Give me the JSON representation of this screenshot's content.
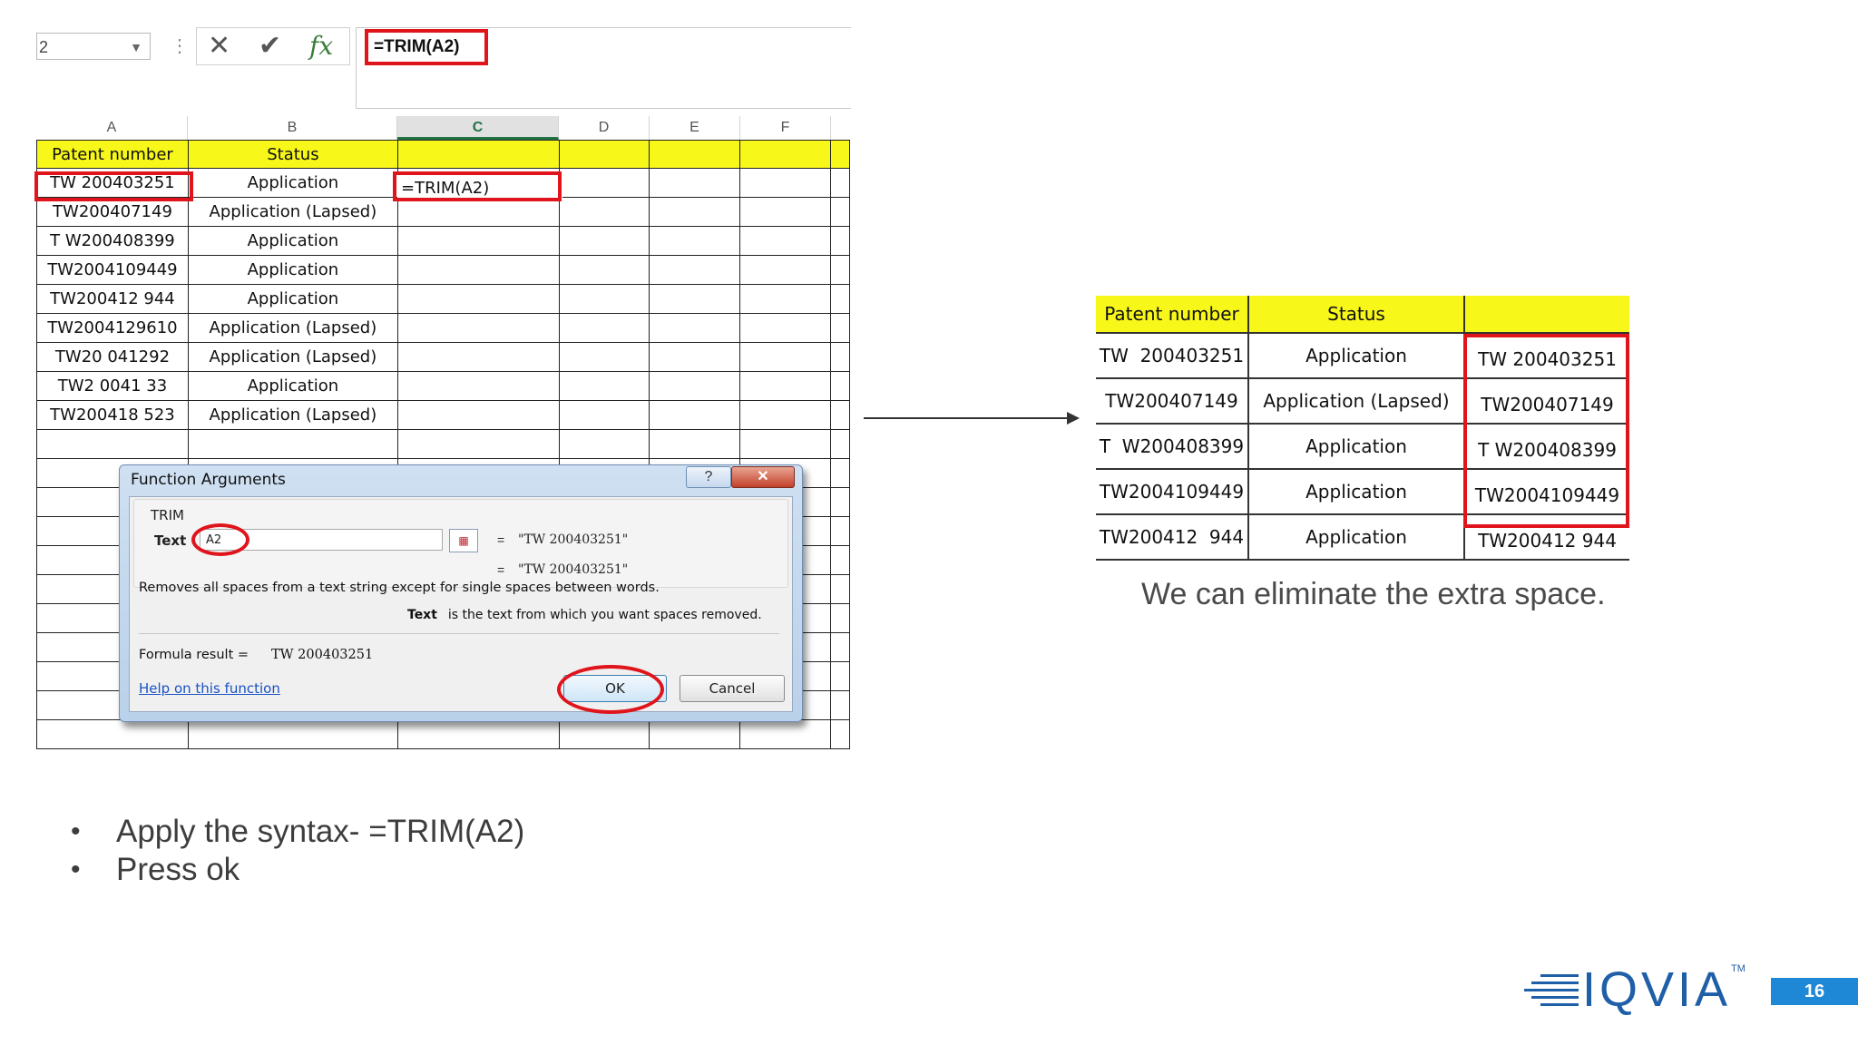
{
  "formula_bar": {
    "name_box": "2",
    "formula": "=TRIM(A2)",
    "icons": [
      "close-icon",
      "check-icon",
      "fx-icon"
    ]
  },
  "sheet": {
    "column_headers": [
      "A",
      "B",
      "C",
      "D",
      "E",
      "F"
    ],
    "selected_column": "C",
    "header_row": [
      "Patent number",
      "Status"
    ],
    "rows": [
      {
        "patent": "TW 200403251",
        "status": "Application"
      },
      {
        "patent": "TW200407149",
        "status": "Application (Lapsed)"
      },
      {
        "patent": "T W200408399",
        "status": "Application"
      },
      {
        "patent": "TW2004109449",
        "status": "Application"
      },
      {
        "patent": "TW200412 944",
        "status": "Application"
      },
      {
        "patent": "TW2004129610",
        "status": "Application (Lapsed)"
      },
      {
        "patent": "TW20 041292",
        "status": "Application (Lapsed)"
      },
      {
        "patent": "TW2 0041 33",
        "status": "Application"
      },
      {
        "patent": "TW200418 523",
        "status": "Application (Lapsed)"
      }
    ],
    "active_cell_content": "=TRIM(A2)",
    "highlight_color": "#f7f71a"
  },
  "dialog": {
    "title": "Function Arguments",
    "help_glyph": "?",
    "close_glyph": "✕",
    "function_name": "TRIM",
    "arg_label": "Text",
    "arg_value": "A2",
    "arg_eq": "=",
    "arg_result": "\"TW 200403251\"",
    "result_eq": "=",
    "result_preview": "\"TW 200403251\"",
    "description": "Removes all spaces from a text string except for single spaces between words.",
    "arg_help_label": "Text",
    "arg_help_text": "is the text from which you want spaces removed.",
    "formula_result_label": "Formula result =",
    "formula_result_value": "TW 200403251",
    "help_link": "Help on this function",
    "ok_label": "OK",
    "cancel_label": "Cancel"
  },
  "result_table": {
    "headers": [
      "Patent number",
      "Status",
      ""
    ],
    "rows": [
      {
        "patent": "TW  200403251",
        "status": "Application",
        "trimmed": "TW 200403251"
      },
      {
        "patent": "TW200407149",
        "status": "Application (Lapsed)",
        "trimmed": "TW200407149"
      },
      {
        "patent": "T  W200408399",
        "status": "Application",
        "trimmed": "T W200408399"
      },
      {
        "patent": "TW2004109449",
        "status": "Application",
        "trimmed": "TW2004109449"
      },
      {
        "patent": "TW200412  944",
        "status": "Application",
        "trimmed": "TW200412 944"
      }
    ]
  },
  "caption": "We can eliminate the extra space.",
  "bullets": [
    "Apply the syntax- =TRIM(A2)",
    "Press ok"
  ],
  "footer": {
    "logo": "IQVIA",
    "tm": "TM",
    "page_number": "16",
    "brand_color": "#1f5fa8",
    "accent_color": "#e0141b"
  }
}
